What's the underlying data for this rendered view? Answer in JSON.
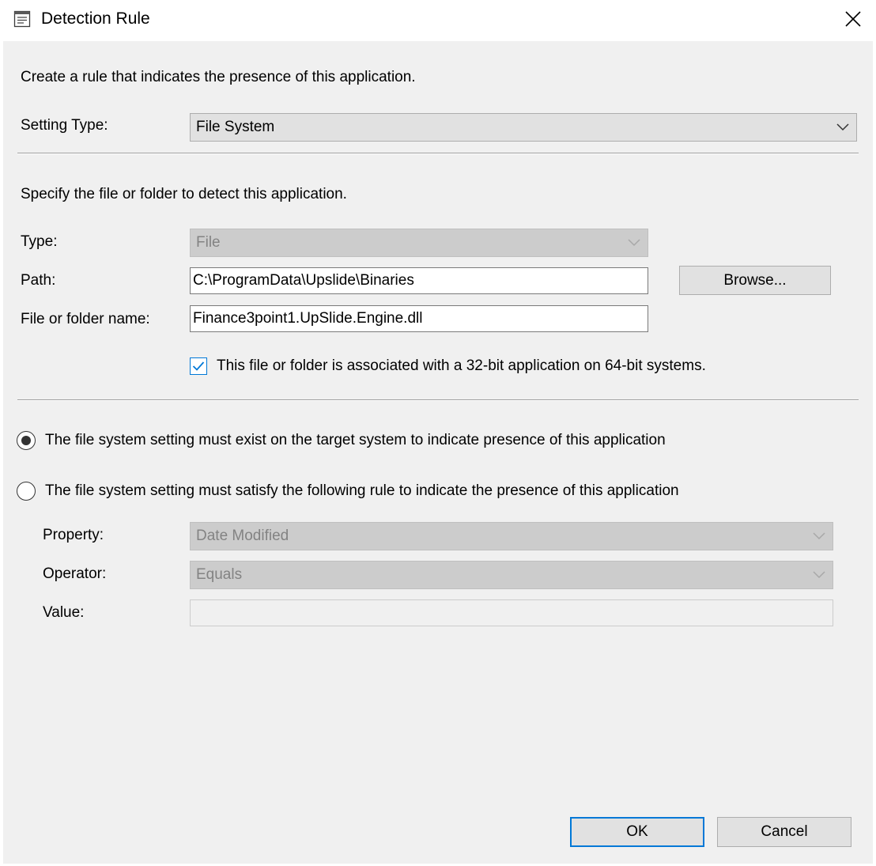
{
  "window": {
    "title": "Detection Rule",
    "title_icon": "dialog-list-icon",
    "close_icon": "close-icon"
  },
  "intro": {
    "text": "Create a rule that indicates the presence of this application."
  },
  "setting_type": {
    "label": "Setting Type:",
    "value": "File System"
  },
  "file_section": {
    "description": "Specify the file or folder to detect this application.",
    "type_label": "Type:",
    "type_value": "File",
    "path_label": "Path:",
    "path_value": "C:\\ProgramData\\Upslide\\Binaries",
    "browse_label": "Browse...",
    "name_label": "File or folder name:",
    "name_value": "Finance3point1.UpSlide.Engine.dll",
    "checkbox_label": "This file or folder is associated with a 32-bit application on 64-bit systems.",
    "checkbox_checked": true
  },
  "rule_options": {
    "option_exist": "The file system setting must exist on the target system to indicate presence of this application",
    "option_rule": "The file system setting must satisfy the following rule to indicate the presence of this application",
    "selected": "option_exist"
  },
  "rule": {
    "property_label": "Property:",
    "property_value": "Date Modified",
    "operator_label": "Operator:",
    "operator_value": "Equals",
    "value_label": "Value:",
    "value_value": ""
  },
  "footer": {
    "ok_label": "OK",
    "cancel_label": "Cancel"
  },
  "colors": {
    "accent": "#0078d7",
    "client_bg": "#f0f0f0",
    "disabled_combo_bg": "#cccccc"
  }
}
